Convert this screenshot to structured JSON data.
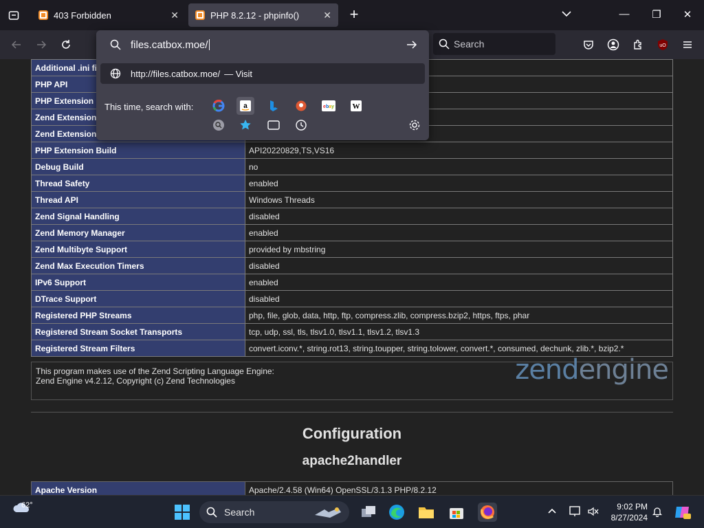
{
  "browser": {
    "tabs": [
      {
        "title": "403 Forbidden",
        "close": "✕"
      },
      {
        "title": "PHP 8.2.12 - phpinfo()",
        "close": "✕"
      }
    ],
    "new_tab": "+",
    "search_placeholder": "Search",
    "window_controls": {
      "minimize": "—",
      "maximize": "❐",
      "close": "✕"
    }
  },
  "urlbar": {
    "typed_value": "files.catbox.moe/",
    "suggestion_url": "http://files.catbox.moe/",
    "suggestion_action": "— Visit",
    "oneoff_label": "This time, search with:",
    "engines": [
      "Google",
      "Amazon",
      "Bing",
      "DuckDuckGo",
      "eBay",
      "Wikipedia",
      "Search engines",
      "Bookmarks",
      "Tabs",
      "History"
    ]
  },
  "phpinfo_rows": [
    {
      "key": "Additional .ini fil",
      "value": ""
    },
    {
      "key": "PHP API",
      "value": ""
    },
    {
      "key": "PHP Extension",
      "value": ""
    },
    {
      "key": "Zend Extension",
      "value": ""
    },
    {
      "key": "Zend Extension",
      "value": ""
    },
    {
      "key": "PHP Extension Build",
      "value": "API20220829,TS,VS16"
    },
    {
      "key": "Debug Build",
      "value": "no"
    },
    {
      "key": "Thread Safety",
      "value": "enabled"
    },
    {
      "key": "Thread API",
      "value": "Windows Threads"
    },
    {
      "key": "Zend Signal Handling",
      "value": "disabled"
    },
    {
      "key": "Zend Memory Manager",
      "value": "enabled"
    },
    {
      "key": "Zend Multibyte Support",
      "value": "provided by mbstring"
    },
    {
      "key": "Zend Max Execution Timers",
      "value": "disabled"
    },
    {
      "key": "IPv6 Support",
      "value": "enabled"
    },
    {
      "key": "DTrace Support",
      "value": "disabled"
    },
    {
      "key": "Registered PHP Streams",
      "value": "php, file, glob, data, http, ftp, compress.zlib, compress.bzip2, https, ftps, phar"
    },
    {
      "key": "Registered Stream Socket Transports",
      "value": "tcp, udp, ssl, tls, tlsv1.0, tlsv1.1, tlsv1.2, tlsv1.3"
    },
    {
      "key": "Registered Stream Filters",
      "value": "convert.iconv.*, string.rot13, string.toupper, string.tolower, convert.*, consumed, dechunk, zlib.*, bzip2.*"
    }
  ],
  "zend": {
    "line1": "This program makes use of the Zend Scripting Language Engine:",
    "line2": "Zend Engine v4.2.12, Copyright (c) Zend Technologies",
    "logo_left": "zend",
    "logo_right": "engine"
  },
  "section": {
    "title": "Configuration",
    "subtitle": "apache2handler"
  },
  "apache_row": {
    "key": "Apache Version",
    "value": "Apache/2.4.58 (Win64) OpenSSL/3.1.3 PHP/8.2.12"
  },
  "taskbar": {
    "temperature": "62°",
    "search_label": "Search",
    "time": "9:02 PM",
    "date": "8/27/2024"
  }
}
